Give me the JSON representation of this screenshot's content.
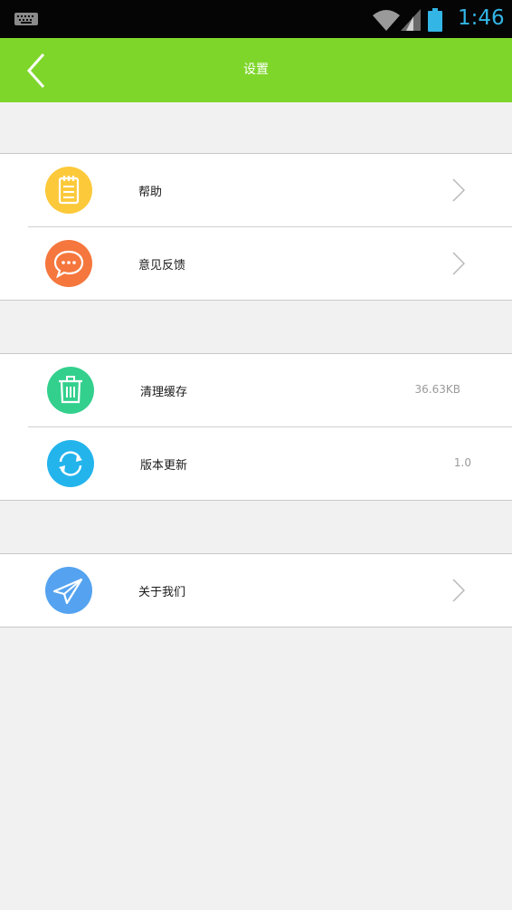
{
  "status_bar": {
    "time": "1:46"
  },
  "header": {
    "title": "设置"
  },
  "groups": [
    {
      "items": [
        {
          "label": "帮助",
          "icon": "notepad-icon",
          "color": "#fcc93a"
        },
        {
          "label": "意见反馈",
          "icon": "chat-bubble-icon",
          "color": "#f5773d"
        }
      ]
    },
    {
      "items": [
        {
          "label": "清理缓存",
          "value": "36.63KB",
          "icon": "trash-icon",
          "color": "#33d08d"
        },
        {
          "label": "版本更新",
          "value": "1.0",
          "icon": "refresh-icon",
          "color": "#24b4ec"
        }
      ]
    },
    {
      "items": [
        {
          "label": "关于我们",
          "icon": "paper-plane-icon",
          "color": "#55a3f0"
        }
      ]
    }
  ],
  "colors": {
    "header": "#7ed62b",
    "status_time": "#33b5e5",
    "background": "#f1f1f1"
  }
}
